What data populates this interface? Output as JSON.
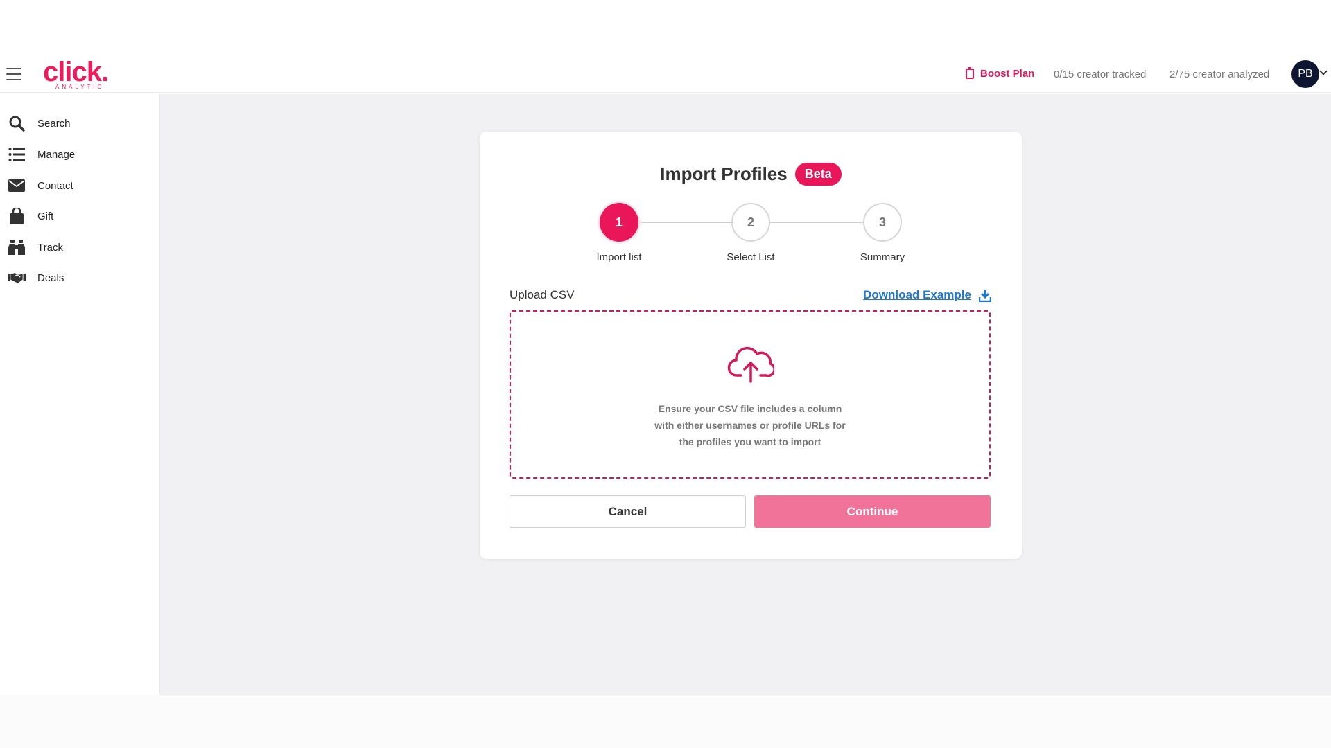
{
  "brand": {
    "name": "click.",
    "tagline": "ANALYTIC",
    "color": "#ec1c5c"
  },
  "header": {
    "plan_label": "Boost Plan",
    "tracked": "0/15 creator tracked",
    "analyzed": "2/75 creator analyzed",
    "avatar_initials": "PB"
  },
  "sidebar": {
    "items": [
      {
        "label": "Search",
        "icon": "search-icon"
      },
      {
        "label": "Manage",
        "icon": "list-icon"
      },
      {
        "label": "Contact",
        "icon": "envelope-icon"
      },
      {
        "label": "Gift",
        "icon": "shopping-bag-icon"
      },
      {
        "label": "Track",
        "icon": "binoculars-icon"
      },
      {
        "label": "Deals",
        "icon": "handshake-icon"
      }
    ]
  },
  "modal": {
    "title": "Import Profiles",
    "badge": "Beta",
    "steps": [
      {
        "number": "1",
        "label": "Import list",
        "active": true
      },
      {
        "number": "2",
        "label": "Select List",
        "active": false
      },
      {
        "number": "3",
        "label": "Summary",
        "active": false
      }
    ],
    "upload_label": "Upload CSV",
    "download_label": "Download Example",
    "dropzone": {
      "icon": "cloud-upload-icon",
      "text_lines": [
        "Ensure your CSV file includes a column",
        "with either usernames or profile URLs for",
        "the profiles you want to import"
      ]
    },
    "cancel_label": "Cancel",
    "continue_label": "Continue"
  },
  "colors": {
    "accent": "#e9175a",
    "continue_bg": "#f2739a",
    "link": "#1e78d0"
  }
}
